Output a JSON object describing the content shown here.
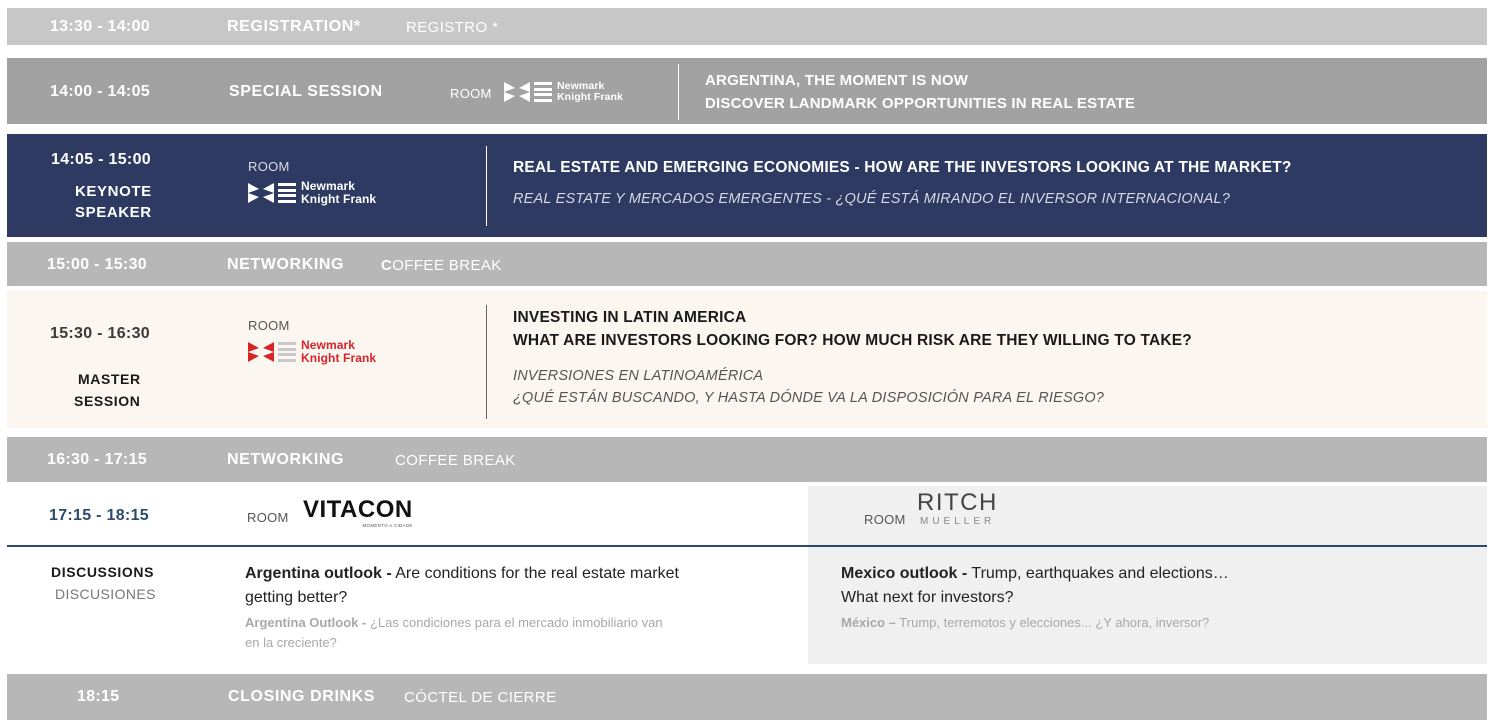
{
  "colors": {
    "registration_bg": "#c7c7c7",
    "special_bg": "#a2a2a2",
    "keynote_bg": "#2e3a62",
    "coffee_bg": "#b7b7b7",
    "master_bg": "#fbf7f0",
    "accent_blue": "#2c4a6e",
    "nkf_red": "#d8232a"
  },
  "registration": {
    "time": "13:30 - 14:00",
    "label": "REGISTRATION*",
    "label_es": "REGISTRO *"
  },
  "special": {
    "time": "14:00 - 14:05",
    "label": "SPECIAL SESSION",
    "room": "ROOM",
    "logo_line1": "Newmark",
    "logo_line2": "Knight Frank",
    "title_line1": "ARGENTINA, THE MOMENT IS NOW",
    "title_line2": "DISCOVER LANDMARK OPPORTUNITIES IN REAL ESTATE"
  },
  "keynote": {
    "time": "14:05 - 15:00",
    "label_line1": "KEYNOTE",
    "label_line2": "SPEAKER",
    "room": "ROOM",
    "logo_line1": "Newmark",
    "logo_line2": "Knight Frank",
    "title": "REAL ESTATE AND EMERGING ECONOMIES - HOW ARE THE INVESTORS LOOKING AT THE MARKET?",
    "title_es": "REAL ESTATE Y MERCADOS EMERGENTES - ¿QUÉ ESTÁ MIRANDO EL INVERSOR INTERNACIONAL?"
  },
  "coffee1": {
    "time": "15:00 - 15:30",
    "label": "NETWORKING",
    "label_es_initial": "C",
    "label_es_rest": "OFFEE BREAK"
  },
  "master": {
    "time": "15:30 - 16:30",
    "label_line1": "MASTER",
    "label_line2": "SESSION",
    "room": "ROOM",
    "logo_line1": "Newmark",
    "logo_line2": "Knight Frank",
    "title_line1": "INVESTING IN LATIN AMERICA",
    "title_line2": "WHAT ARE INVESTORS LOOKING FOR? HOW MUCH RISK ARE THEY WILLING TO TAKE?",
    "title_es_line1": "INVERSIONES EN LATINOAMÉRICA",
    "title_es_line2": "¿QUÉ ESTÁN BUSCANDO, Y HASTA DÓNDE VA LA DISPOSICIÓN PARA EL RIESGO?"
  },
  "coffee2": {
    "time": "16:30 - 17:15",
    "label": "NETWORKING",
    "label_es": "COFFEE BREAK"
  },
  "discussions": {
    "time": "17:15 - 18:15",
    "label": "DISCUSSIONS",
    "label_es": "DISCUSIONES",
    "room_left": "ROOM",
    "vitacon_logo": "VITACON",
    "vitacon_tagline": "MOMENTO A CIDADE",
    "room_right": "ROOM",
    "ritch_line1": "RITCH",
    "ritch_line2": "MUELLER",
    "arg_title": "Argentina outlook -",
    "arg_text_line1": " Are conditions for the real estate market",
    "arg_text_line2": "getting better?",
    "arg_es_title": "Argentina Outlook -",
    "arg_es_text_line1": " ¿Las condiciones para el mercado inmobiliario van",
    "arg_es_text_line2": "en la creciente?",
    "mex_title": "Mexico outlook -",
    "mex_text_line1": " Trump, earthquakes and elections…",
    "mex_text_line2": "What next for investors?",
    "mex_es_title": "México –",
    "mex_es_text": " Trump, terremotos y elecciones... ¿Y ahora, inversor?"
  },
  "closing": {
    "time": "18:15",
    "label": "CLOSING DRINKS",
    "label_es": "CÓCTEL DE CIERRE"
  }
}
